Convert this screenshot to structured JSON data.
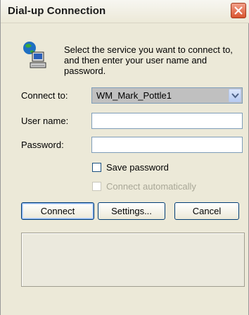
{
  "window": {
    "title": "Dial-up Connection"
  },
  "icons": {
    "close": "close-icon",
    "app": "network-computer-icon",
    "dropdown": "chevron-down-icon"
  },
  "intro": {
    "text": "Select the service you want to connect to, and then enter your user name and password."
  },
  "form": {
    "connect_to": {
      "label": "Connect to:",
      "value": "WM_Mark_Pottle1"
    },
    "username": {
      "label": "User name:",
      "value": ""
    },
    "password": {
      "label": "Password:",
      "value": ""
    },
    "save_password": {
      "label": "Save password",
      "checked": false
    },
    "connect_auto": {
      "label": "Connect automatically",
      "checked": false,
      "enabled": false
    }
  },
  "buttons": {
    "connect": "Connect",
    "settings": "Settings...",
    "cancel": "Cancel"
  },
  "status": {
    "text": ""
  },
  "colors": {
    "window_bg": "#ece9d8",
    "field_border": "#7f9db9",
    "close_red": "#d9542f"
  }
}
